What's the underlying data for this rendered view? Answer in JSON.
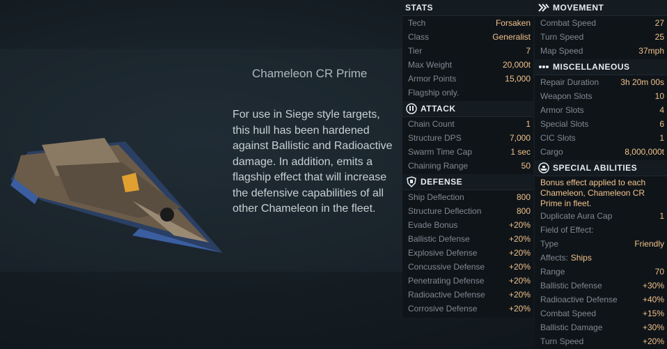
{
  "ship": {
    "name": "Chameleon CR Prime",
    "description": "For use in Siege style targets, this hull has been hardened against Ballistic and Radioactive damage. In addition, emits a flagship effect that will increase the defensive capabilities of all other Chameleon in the fleet."
  },
  "stats": {
    "header": "STATS",
    "rows": [
      {
        "label": "Tech",
        "value": "Forsaken"
      },
      {
        "label": "Class",
        "value": "Generalist"
      },
      {
        "label": "Tier",
        "value": "7"
      },
      {
        "label": "Max Weight",
        "value": "20,000t"
      },
      {
        "label": "Armor Points",
        "value": "15,000"
      },
      {
        "label": "Flagship only.",
        "value": ""
      }
    ]
  },
  "attack": {
    "header": "ATTACK",
    "rows": [
      {
        "label": "Chain Count",
        "value": "1"
      },
      {
        "label": "Structure DPS",
        "value": "7,000"
      },
      {
        "label": "Swarm Time Cap",
        "value": "1 sec"
      },
      {
        "label": "Chaining Range",
        "value": "50"
      }
    ]
  },
  "defense": {
    "header": "DEFENSE",
    "rows": [
      {
        "label": "Ship Deflection",
        "value": "800"
      },
      {
        "label": "Structure Deflection",
        "value": "800"
      },
      {
        "label": "Evade Bonus",
        "value": "+20%"
      },
      {
        "label": "Ballistic Defense",
        "value": "+20%"
      },
      {
        "label": "Explosive Defense",
        "value": "+20%"
      },
      {
        "label": "Concussive Defense",
        "value": "+20%"
      },
      {
        "label": "Penetrating Defense",
        "value": "+20%"
      },
      {
        "label": "Radioactive Defense",
        "value": "+20%"
      },
      {
        "label": "Corrosive Defense",
        "value": "+20%"
      }
    ]
  },
  "movement": {
    "header": "MOVEMENT",
    "rows": [
      {
        "label": "Combat Speed",
        "value": "27"
      },
      {
        "label": "Turn Speed",
        "value": "25"
      },
      {
        "label": "Map Speed",
        "value": "37mph"
      }
    ]
  },
  "misc": {
    "header": "MISCELLANEOUS",
    "rows": [
      {
        "label": "Repair Duration",
        "value": "3h 20m 00s"
      },
      {
        "label": "Weapon Slots",
        "value": "10"
      },
      {
        "label": "Armor Slots",
        "value": "4"
      },
      {
        "label": "Special Slots",
        "value": "6"
      },
      {
        "label": "CIC Slots",
        "value": "1"
      },
      {
        "label": "Cargo",
        "value": "8,000,000t"
      }
    ]
  },
  "special": {
    "header": "SPECIAL ABILITIES",
    "note": "Bonus effect applied to each Chameleon, Chameleon CR Prime in fleet.",
    "dup_label": "Duplicate Aura Cap",
    "dup_value": "1",
    "field_label": "Field of Effect:",
    "type_label": "Type",
    "type_value": "Friendly",
    "affects_label": "Affects:",
    "affects_value": "Ships",
    "rows": [
      {
        "label": "Range",
        "value": "70"
      },
      {
        "label": "Ballistic Defense",
        "value": "+30%"
      },
      {
        "label": "Radioactive Defense",
        "value": "+40%"
      },
      {
        "label": "Combat Speed",
        "value": "+15%"
      },
      {
        "label": "Ballistic Damage",
        "value": "+30%"
      },
      {
        "label": "Turn Speed",
        "value": "+20%"
      }
    ]
  },
  "colors": {
    "value": "#f0c28a",
    "label": "#7f8a91",
    "panel": "#0f1419",
    "header": "#141b21"
  }
}
